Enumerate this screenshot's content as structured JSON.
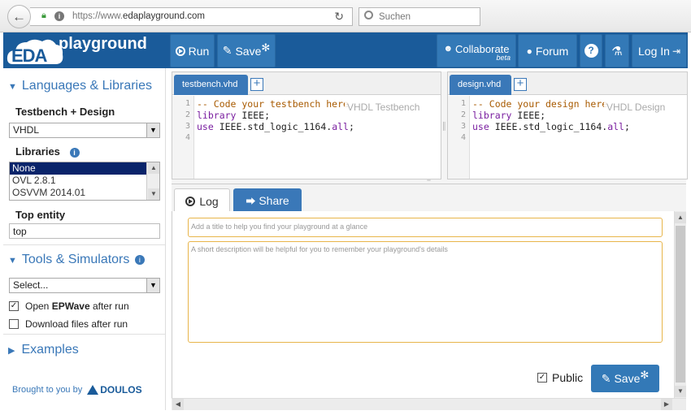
{
  "browser": {
    "url_host": "https://www.",
    "url_domain": "edaplayground.com",
    "search_placeholder": "Suchen"
  },
  "navbar": {
    "logo_eda": "EDA",
    "logo_playground": "playground",
    "run": "Run",
    "save": "Save",
    "collaborate": "Collaborate",
    "collaborate_beta": "beta",
    "forum": "Forum",
    "help": "?",
    "login": "Log In"
  },
  "sidebar": {
    "languages_title": "Languages & Libraries",
    "testbench_label": "Testbench + Design",
    "language_value": "VHDL",
    "libraries_label": "Libraries",
    "libraries_options": [
      "None",
      "OVL 2.8.1",
      "OSVVM 2014.01"
    ],
    "top_entity_label": "Top entity",
    "top_entity_value": "top",
    "tools_title": "Tools & Simulators",
    "tools_select": "Select...",
    "open_epwave": "Open ",
    "open_epwave_bold": "EPWave",
    "open_epwave_after": " after run",
    "download_files": "Download files after run",
    "examples_title": "Examples",
    "brought_by": "Brought to you by",
    "doulos": "DOULOS"
  },
  "editor_left": {
    "tab": "testbench.vhd",
    "placeholder": "VHDL Testbench",
    "lines": [
      "1",
      "2",
      "3",
      "4"
    ],
    "code_comment": "-- Code your testbench here",
    "code_line2_kw": "library",
    "code_line2_rest": " IEEE;",
    "code_line3_kw": "use",
    "code_line3_mid": " IEEE.std_logic_1164.",
    "code_line3_kw2": "all",
    "code_line3_end": ";"
  },
  "editor_right": {
    "tab": "design.vhd",
    "placeholder": "VHDL Design",
    "lines": [
      "1",
      "2",
      "3",
      "4"
    ],
    "code_comment": "-- Code your design here",
    "code_line2_kw": "library",
    "code_line2_rest": " IEEE;",
    "code_line3_kw": "use",
    "code_line3_mid": " IEEE.std_logic_1164.",
    "code_line3_kw2": "all",
    "code_line3_end": ";"
  },
  "bottom": {
    "log_tab": "Log",
    "share_tab": "Share",
    "title_placeholder": "Add a title to help you find your playground at a glance",
    "desc_placeholder": "A short description will be helpful for you to remember your playground's details",
    "public_label": "Public",
    "save_button": "Save"
  },
  "colors": {
    "navbar": "#1a5b9a",
    "button": "#3379b7",
    "accent": "#3a78b8",
    "input_border": "#e8b54a"
  }
}
